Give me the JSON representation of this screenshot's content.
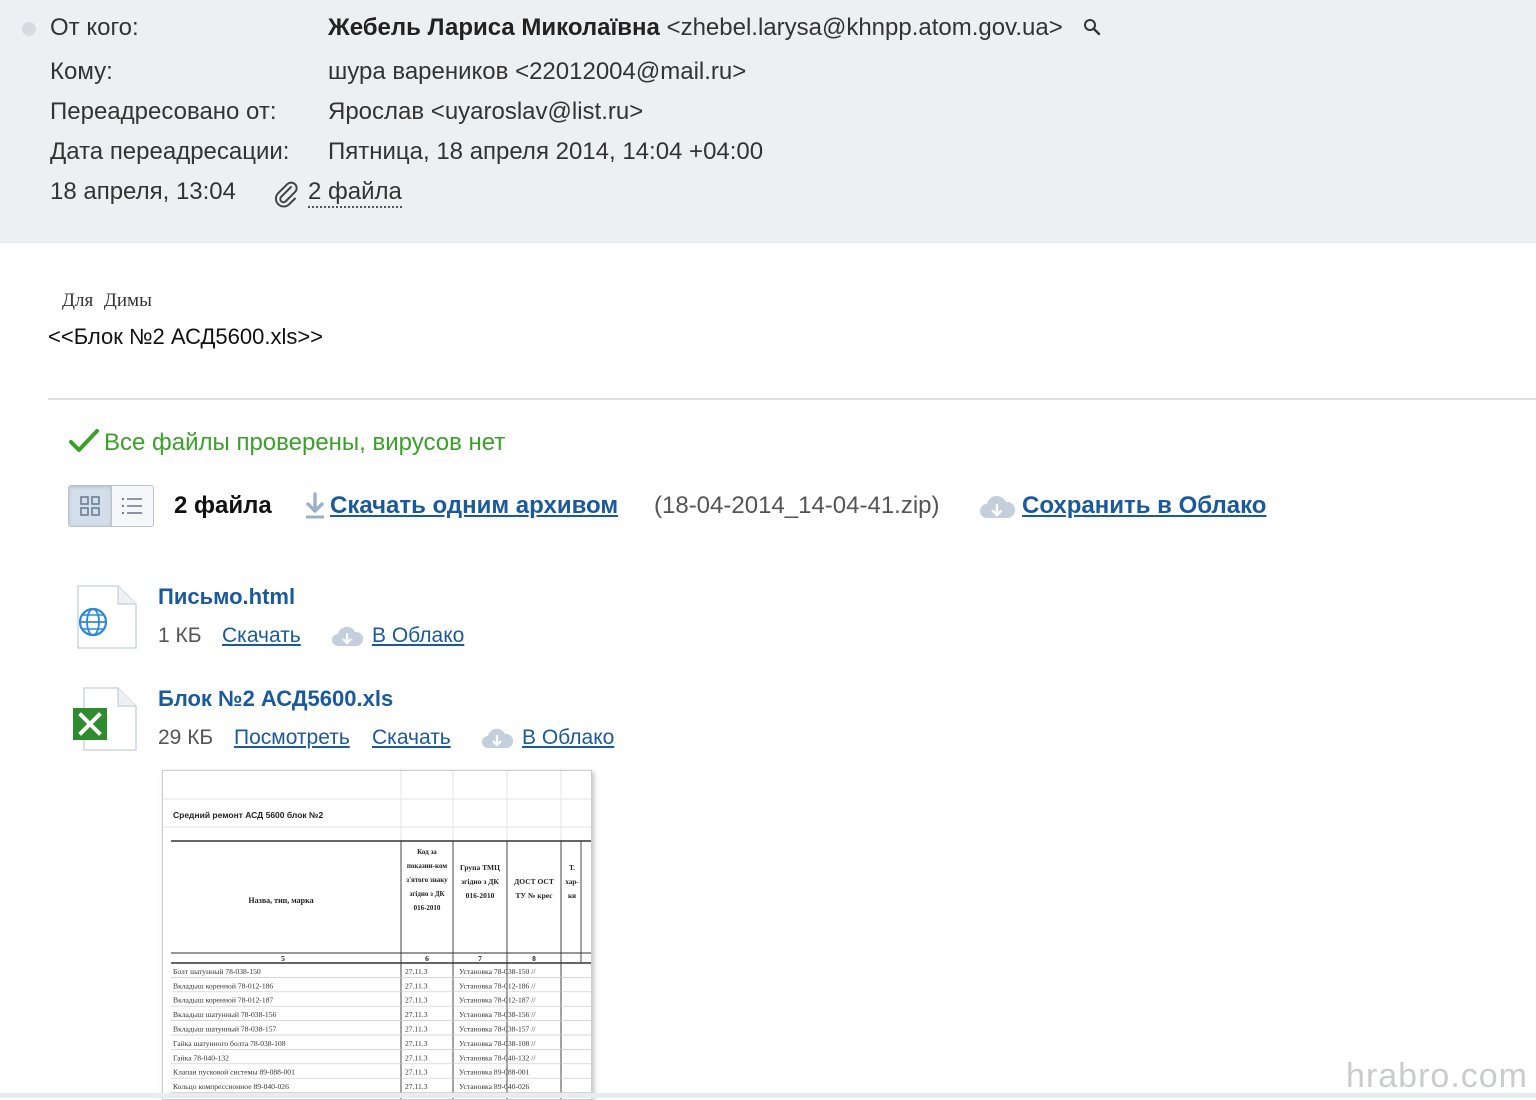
{
  "header": {
    "from_label": "От кого:",
    "sender_name": "Жебель Лариса Миколаївна",
    "sender_email": "<zhebel.larysa@khnpp.atom.gov.ua>",
    "to_label": "Кому:",
    "to_value": "шура вареников <22012004@mail.ru>",
    "forwarded_label": "Переадресовано от:",
    "forwarded_value": "Ярослав <uyaroslav@list.ru>",
    "forward_date_label": "Дата переадресации:",
    "forward_date_value": "Пятница, 18 апреля 2014, 14:04 +04:00",
    "date": "18 апреля, 13:04",
    "files_count": "2 файла"
  },
  "body": {
    "greeting": "Для Димы",
    "attachment_ref": "<<Блок №2 АСД5600.xls>>"
  },
  "attachments": {
    "virus_status": "Все файлы проверены, вирусов нет",
    "summary": "2 файла",
    "download_archive": "Скачать одним архивом",
    "archive_name": "(18-04-2014_14-04-41.zip)",
    "save_to_cloud": "Сохранить в Облако",
    "files": [
      {
        "name": "Письмо.html",
        "size": "1 КБ",
        "download": "Скачать",
        "to_cloud": "В Облако",
        "icon": "globe-file-icon"
      },
      {
        "name": "Блок №2 АСД5600.xls",
        "size": "29 КБ",
        "view": "Посмотреть",
        "download": "Скачать",
        "to_cloud": "В Облако",
        "icon": "excel-file-icon"
      }
    ]
  },
  "preview": {
    "title": "Средний ремонт АСД 5600 блок №2",
    "col_name": "Назва, тип, марка",
    "col_code": "Код за показни-ком з'ятого знаку згідно з ДК 016-2010",
    "col_group": "Група ТМЦ згідно з ДК 016-2010",
    "col_gost": "ДОСТ ОСТ ТУ № крес",
    "col_char": "Т. хар-ки",
    "col_num_name": "5",
    "col_num_code": "6",
    "col_num_group": "7",
    "col_num_gost": "8",
    "rows": [
      {
        "name": "Болт шатунный 78-038-150",
        "code": "27.11.3",
        "group": "Установка 78-038-150 //"
      },
      {
        "name": "Вкладыш коренной 78-012-186",
        "code": "27.11.3",
        "group": "Установка 78-012-186 //"
      },
      {
        "name": "Вкладыш коренной 78-012-187",
        "code": "27.11.3",
        "group": "Установка 78-012-187 //"
      },
      {
        "name": "Вкладыш шатунный 78-038-156",
        "code": "27.11.3",
        "group": "Установка 78-038-156 //"
      },
      {
        "name": "Вкладыш шатунный 78-038-157",
        "code": "27.11.3",
        "group": "Установка 78-038-157 //"
      },
      {
        "name": "Гайка шатунного болта 78-038-108",
        "code": "27.11.3",
        "group": "Установка 78-038-108 //"
      },
      {
        "name": "Гайка 78-040-132",
        "code": "27.11.3",
        "group": "Установка 78-040-132 //"
      },
      {
        "name": "Клапан пусковой системы 89-088-001",
        "code": "27.11.3",
        "group": "Установка 89-088-001"
      },
      {
        "name": "Кольцо компрессионное 89-040-026",
        "code": "27.11.3",
        "group": "Установка 89-040-026"
      }
    ]
  },
  "watermark": "hrabro.com",
  "colors": {
    "header_bg": "#edf0f3",
    "link": "#1a5a9c",
    "virus_ok": "#3aa02a",
    "watermark": "#c9cbcd"
  }
}
